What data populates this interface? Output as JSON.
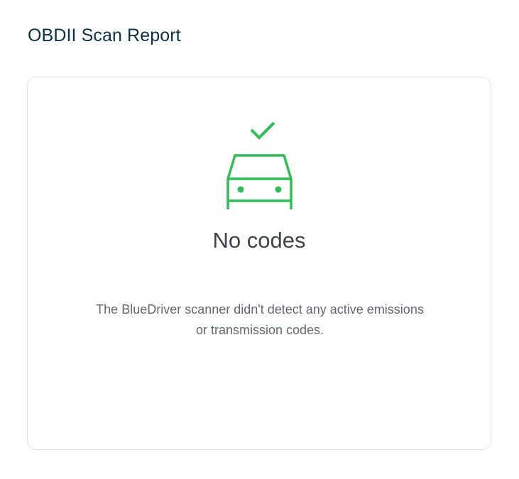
{
  "header": {
    "title": "OBDII Scan Report"
  },
  "result": {
    "heading": "No codes",
    "description": "The BlueDriver scanner didn't detect any active emissions or transmission codes.",
    "icons": [
      "checkmark-icon",
      "car-front-icon"
    ],
    "status_color": "#2fbe54"
  },
  "colors": {
    "title": "#0c3144",
    "heading": "#3f4447",
    "body_text": "#62686c",
    "card_border": "#e3e6e8"
  }
}
